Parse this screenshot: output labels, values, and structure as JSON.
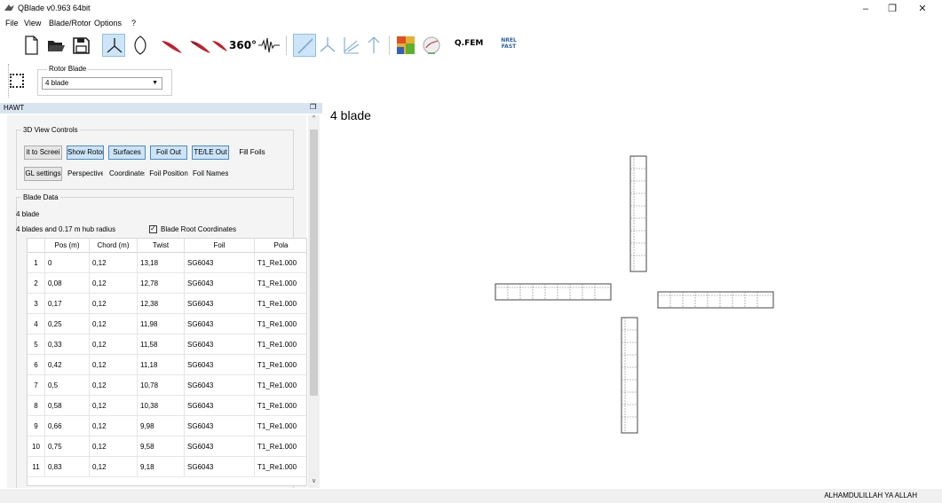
{
  "window": {
    "title": "QBlade v0.963 64bit"
  },
  "menu": [
    "File",
    "View",
    "Blade/Rotor",
    "Options",
    "?"
  ],
  "toolbar": {
    "icons": [
      "new-file-icon",
      "open-folder-icon",
      "save-icon",
      "hawt-icon",
      "vawt-icon",
      "airfoil-icon",
      "xfoil-icon",
      "360-polar-icon",
      "extrapolation-icon",
      "blade-design-icon",
      "rotor-simulation-icon",
      "multi-param-icon",
      "turbine-icon",
      "qfem-heatmap-icon",
      "wind-field-icon",
      "qfem-icon",
      "nrel-fast-icon"
    ],
    "label_360": "360°",
    "label_qfem": "Q.FEM",
    "label_nrel": "NREL FAST"
  },
  "rotor_blade": {
    "title": "Rotor Blade",
    "selected": "4 blade"
  },
  "dock": {
    "title": "HAWT"
  },
  "view_controls": {
    "title": "3D View Controls",
    "buttons_row1": [
      "it to Screei",
      "Show Rotor",
      "Surfaces",
      "Foil Out",
      "TE/LE Out",
      "Fill Foils"
    ],
    "buttons_row2": [
      "GL settings",
      "Perspective",
      "Coordinates",
      "Foil Position",
      "Foil Names"
    ]
  },
  "blade_data": {
    "title": "Blade Data",
    "name": "4 blade",
    "info": "4 blades and 0.17 m hub radius",
    "root_coords_label": "Blade Root Coordinates",
    "columns": [
      "Pos (m)",
      "Chord (m)",
      "Twist",
      "Foil",
      "Pola"
    ],
    "rows": [
      {
        "n": "1",
        "pos": "0",
        "chord": "0,12",
        "twist": "13,18",
        "foil": "SG6043",
        "polar": "T1_Re1.000"
      },
      {
        "n": "2",
        "pos": "0,08",
        "chord": "0,12",
        "twist": "12,78",
        "foil": "SG6043",
        "polar": "T1_Re1.000"
      },
      {
        "n": "3",
        "pos": "0,17",
        "chord": "0,12",
        "twist": "12,38",
        "foil": "SG6043",
        "polar": "T1_Re1.000"
      },
      {
        "n": "4",
        "pos": "0,25",
        "chord": "0,12",
        "twist": "11,98",
        "foil": "SG6043",
        "polar": "T1_Re1.000"
      },
      {
        "n": "5",
        "pos": "0,33",
        "chord": "0,12",
        "twist": "11,58",
        "foil": "SG6043",
        "polar": "T1_Re1.000"
      },
      {
        "n": "6",
        "pos": "0,42",
        "chord": "0,12",
        "twist": "11,18",
        "foil": "SG6043",
        "polar": "T1_Re1.000"
      },
      {
        "n": "7",
        "pos": "0,5",
        "chord": "0,12",
        "twist": "10,78",
        "foil": "SG6043",
        "polar": "T1_Re1.000"
      },
      {
        "n": "8",
        "pos": "0,58",
        "chord": "0,12",
        "twist": "10,38",
        "foil": "SG6043",
        "polar": "T1_Re1.000"
      },
      {
        "n": "9",
        "pos": "0,66",
        "chord": "0,12",
        "twist": "9,98",
        "foil": "SG6043",
        "polar": "T1_Re1.000"
      },
      {
        "n": "10",
        "pos": "0,75",
        "chord": "0,12",
        "twist": "9,58",
        "foil": "SG6043",
        "polar": "T1_Re1.000"
      },
      {
        "n": "11",
        "pos": "0,83",
        "chord": "0,12",
        "twist": "9,18",
        "foil": "SG6043",
        "polar": "T1_Re1.000"
      }
    ]
  },
  "viewport": {
    "title": "4 blade"
  },
  "status": {
    "text": "ALHAMDULILLAH YA ALLAH"
  }
}
